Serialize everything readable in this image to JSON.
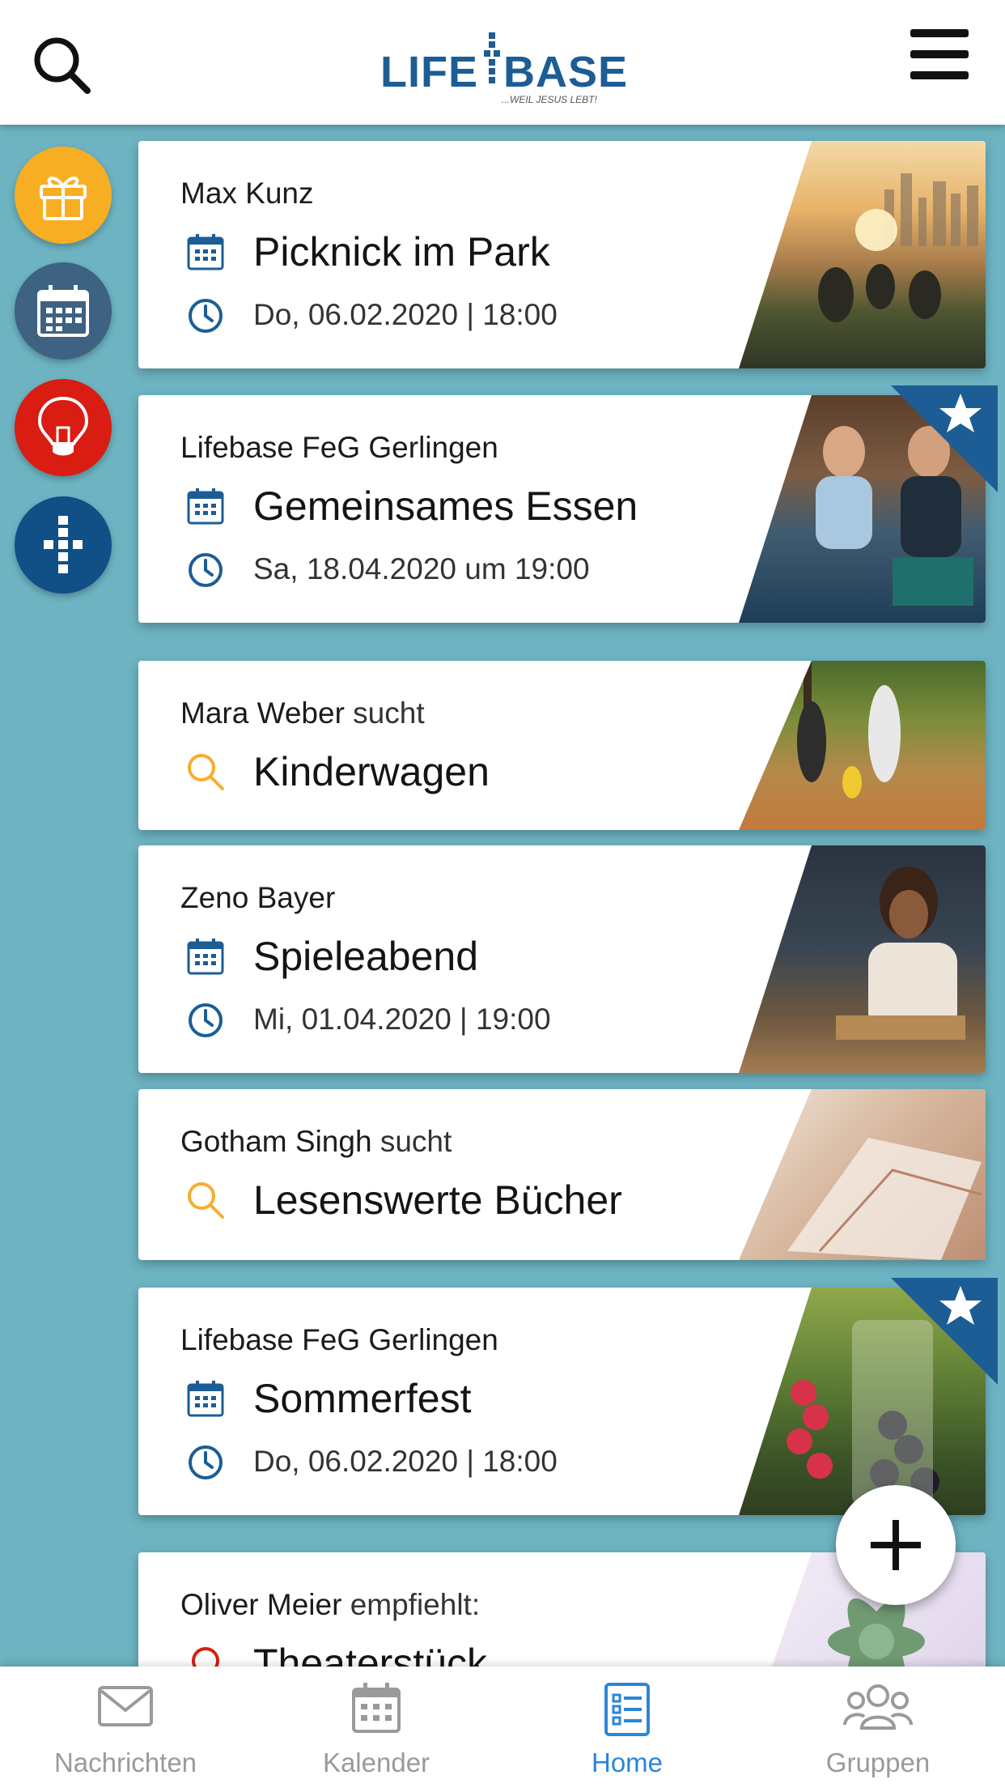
{
  "header": {
    "logo_left": "LIFE",
    "logo_right": "BASE",
    "logo_tagline": "...WEIL JESUS LEBT!"
  },
  "side_actions": [
    {
      "icon": "gift-icon",
      "color": "#f8ae22"
    },
    {
      "icon": "calendar-icon",
      "color": "#3e6282"
    },
    {
      "icon": "lightbulb-icon",
      "color": "#d91d12"
    },
    {
      "icon": "cross-icon",
      "color": "#114f87"
    }
  ],
  "cards": [
    {
      "author": "Max Kunz",
      "author_suffix": "",
      "title": "Picknick im Park",
      "meta": "Do, 06.02.2020 | 18:00",
      "kind": "event",
      "featured": false
    },
    {
      "author": "Lifebase FeG Gerlingen",
      "author_suffix": "",
      "title": "Gemeinsames Essen",
      "meta": "Sa, 18.04.2020 um 19:00",
      "kind": "event",
      "featured": true
    },
    {
      "author": "Mara Weber",
      "author_suffix": "sucht",
      "title": "Kinderwagen",
      "meta": "",
      "kind": "search",
      "featured": false
    },
    {
      "author": "Zeno Bayer",
      "author_suffix": "",
      "title": "Spieleabend",
      "meta": "Mi, 01.04.2020 | 19:00",
      "kind": "event",
      "featured": false
    },
    {
      "author": "Gotham Singh",
      "author_suffix": "sucht",
      "title": "Lesenswerte Bücher",
      "meta": "",
      "kind": "search",
      "featured": false
    },
    {
      "author": "Lifebase FeG Gerlingen",
      "author_suffix": "",
      "title": "Sommerfest",
      "meta": "Do, 06.02.2020 | 18:00",
      "kind": "event",
      "featured": true
    },
    {
      "author": "Oliver Meier",
      "author_suffix": "empfiehlt:",
      "title": "Theaterstück",
      "meta": "",
      "kind": "recommendation",
      "featured": false
    }
  ],
  "bottom_nav": [
    {
      "label": "Nachrichten",
      "icon": "envelope-icon",
      "active": false
    },
    {
      "label": "Kalender",
      "icon": "calendar-icon",
      "active": false
    },
    {
      "label": "Home",
      "icon": "list-icon",
      "active": true
    },
    {
      "label": "Gruppen",
      "icon": "people-icon",
      "active": false
    }
  ],
  "colors": {
    "background": "#6db3c2",
    "primary_blue": "#1d5d95",
    "active_nav": "#2a86d6",
    "search_icon": "#f6ae2d",
    "recommend_icon": "#d91d12"
  }
}
